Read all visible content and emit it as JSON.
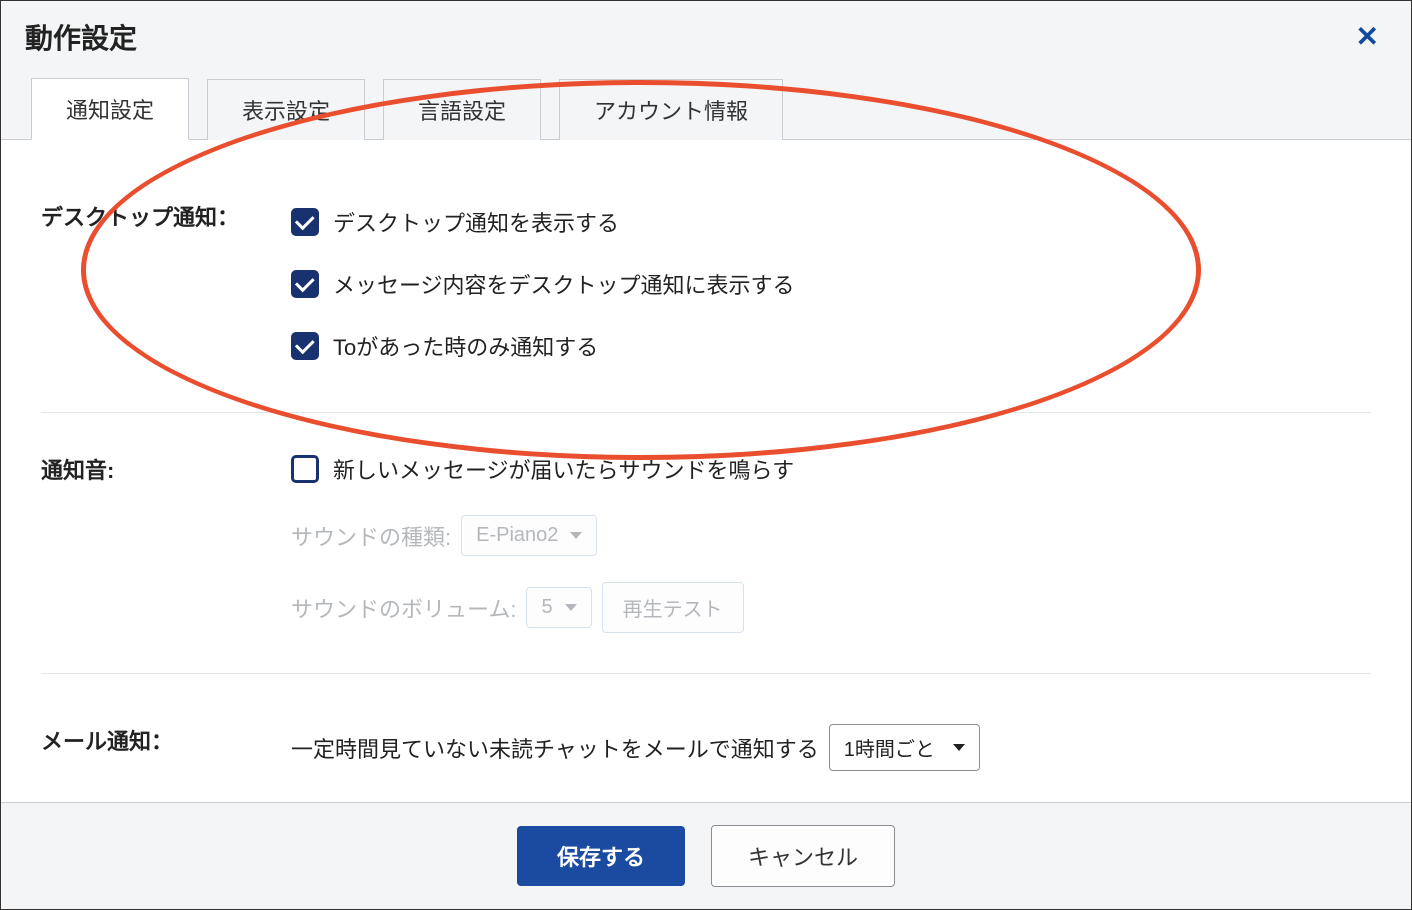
{
  "dialog": {
    "title": "動作設定"
  },
  "tabs": [
    {
      "label": "通知設定",
      "active": true
    },
    {
      "label": "表示設定",
      "active": false
    },
    {
      "label": "言語設定",
      "active": false
    },
    {
      "label": "アカウント情報",
      "active": false
    }
  ],
  "sections": {
    "desktop": {
      "label": "デスクトップ通知：",
      "items": [
        {
          "checked": true,
          "label": "デスクトップ通知を表示する"
        },
        {
          "checked": true,
          "label": "メッセージ内容をデスクトップ通知に表示する"
        },
        {
          "checked": true,
          "label": "Toがあった時のみ通知する"
        }
      ]
    },
    "sound": {
      "label": "通知音:",
      "enable": {
        "checked": false,
        "label": "新しいメッセージが届いたらサウンドを鳴らす"
      },
      "type": {
        "label": "サウンドの種類:",
        "value": "E-Piano2"
      },
      "volume": {
        "label": "サウンドのボリューム:",
        "value": "5",
        "test_button": "再生テスト"
      }
    },
    "email": {
      "label": "メール通知：",
      "description": "一定時間見ていない未読チャットをメールで通知する",
      "interval": "1時間ごと"
    }
  },
  "footer": {
    "save": "保存する",
    "cancel": "キャンセル"
  }
}
